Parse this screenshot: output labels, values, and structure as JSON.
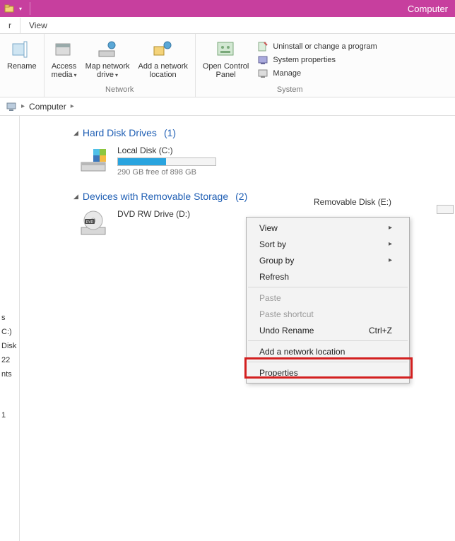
{
  "title": "Computer",
  "tabs": {
    "left": "r",
    "view": "View"
  },
  "ribbon": {
    "rename": "Rename",
    "access_media": "Access\nmedia",
    "map_network_drive": "Map network\ndrive",
    "add_network_location": "Add a network\nlocation",
    "network_group": "Network",
    "open_control_panel": "Open Control\nPanel",
    "uninstall": "Uninstall or change a program",
    "system_properties": "System properties",
    "manage": "Manage",
    "system_group": "System"
  },
  "breadcrumb": {
    "computer": "Computer"
  },
  "nav": {
    "line1": "s",
    "line2": "C:)",
    "line3": "Disk (E:)",
    "line4": "22",
    "line5": "nts",
    "line6": "1"
  },
  "groups": {
    "hdd": {
      "title": "Hard Disk Drives",
      "count": "(1)"
    },
    "removable": {
      "title": "Devices with Removable Storage",
      "count": "(2)"
    }
  },
  "drives": {
    "local": {
      "name": "Local Disk (C:)",
      "free": "290 GB free of 898 GB"
    },
    "dvd": {
      "name": "DVD RW Drive (D:)"
    },
    "removable": {
      "name": "Removable Disk (E:)"
    }
  },
  "context_menu": {
    "view": "View",
    "sort_by": "Sort by",
    "group_by": "Group by",
    "refresh": "Refresh",
    "paste": "Paste",
    "paste_shortcut": "Paste shortcut",
    "undo_rename": "Undo Rename",
    "undo_shortcut": "Ctrl+Z",
    "add_network_location": "Add a network location",
    "properties": "Properties"
  }
}
